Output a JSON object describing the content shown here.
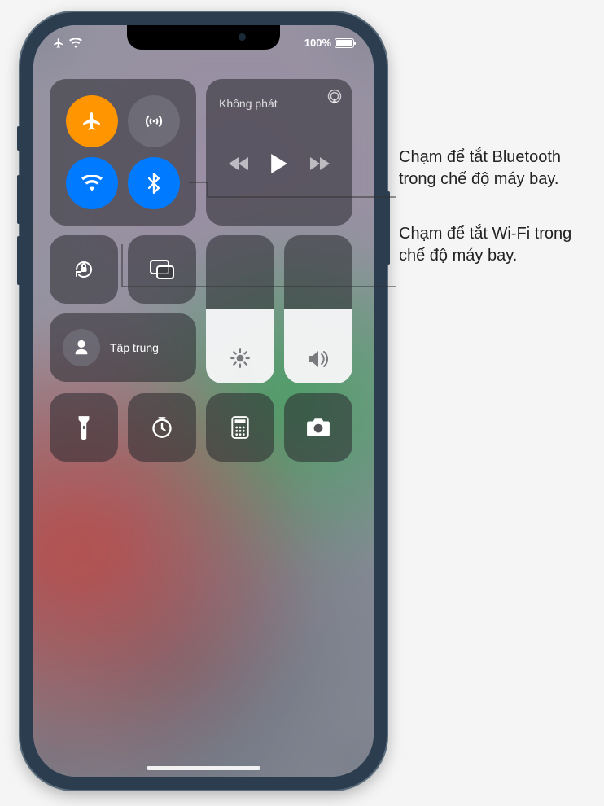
{
  "status": {
    "battery_pct": "100%"
  },
  "connectivity": {
    "airplane_on": true,
    "cellular_on": false,
    "wifi_on": true,
    "bluetooth_on": true
  },
  "media": {
    "title": "Không phát"
  },
  "focus": {
    "label": "Tập trung"
  },
  "sliders": {
    "brightness_pct": 50,
    "volume_pct": 50
  },
  "callouts": {
    "bluetooth": "Chạm để tắt Bluetooth trong chế độ máy bay.",
    "wifi": "Chạm để tắt Wi-Fi trong chế độ máy bay."
  }
}
